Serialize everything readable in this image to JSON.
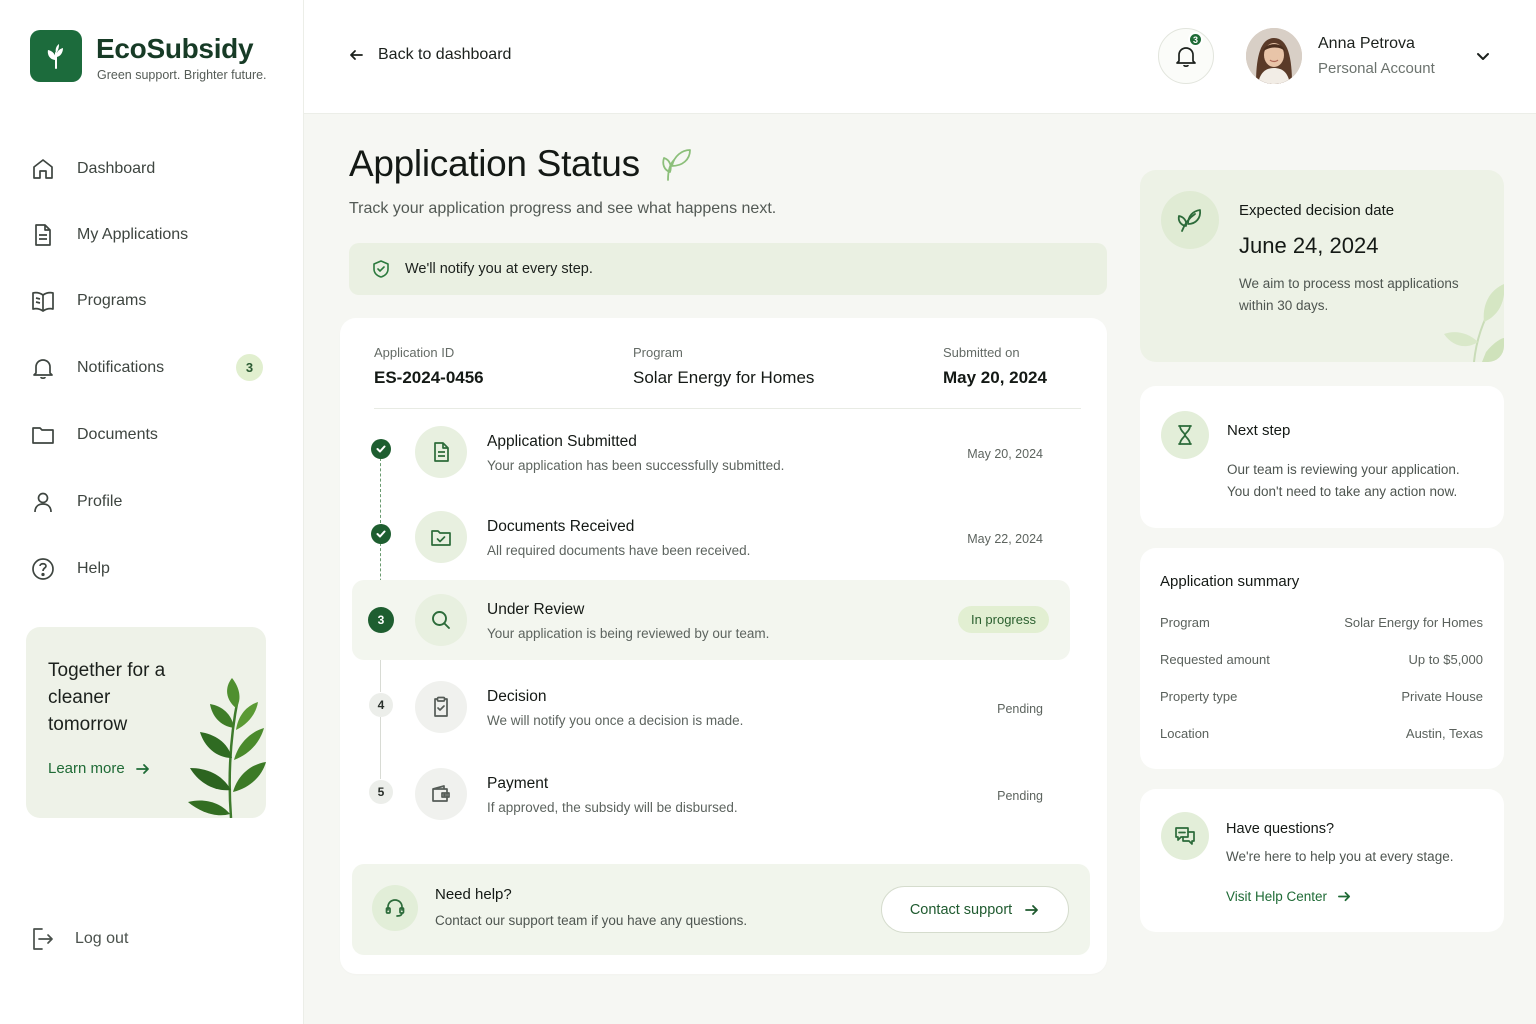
{
  "brand": {
    "name": "EcoSubsidy",
    "tagline": "Green support. Brighter future."
  },
  "nav": [
    {
      "label": "Dashboard",
      "icon": "home-icon"
    },
    {
      "label": "My Applications",
      "icon": "document-icon"
    },
    {
      "label": "Programs",
      "icon": "book-icon"
    },
    {
      "label": "Notifications",
      "icon": "bell-icon",
      "badge": "3"
    },
    {
      "label": "Documents",
      "icon": "folder-icon"
    },
    {
      "label": "Profile",
      "icon": "user-icon"
    },
    {
      "label": "Help",
      "icon": "help-circle-icon"
    }
  ],
  "promo": {
    "title": "Together for a cleaner tomorrow",
    "link": "Learn more"
  },
  "logout": "Log out",
  "header": {
    "back": "Back to dashboard",
    "notifications_count": "3",
    "user_name": "Anna Petrova",
    "user_account": "Personal Account"
  },
  "page": {
    "title": "Application Status",
    "subtitle": "Track your application progress and see what happens next.",
    "notice": "We'll notify you at every step."
  },
  "application": {
    "id_label": "Application ID",
    "id": "ES-2024-0456",
    "program_label": "Program",
    "program": "Solar Energy for Homes",
    "submitted_label": "Submitted on",
    "submitted": "May 20, 2024"
  },
  "steps": [
    {
      "title": "Application Submitted",
      "desc": "Your application has been successfully submitted.",
      "status": "May 20, 2024",
      "state": "done",
      "icon": "file-text-icon"
    },
    {
      "title": "Documents Received",
      "desc": "All required documents have been received.",
      "status": "May 22, 2024",
      "state": "done",
      "icon": "folder-check-icon"
    },
    {
      "num": "3",
      "title": "Under Review",
      "desc": "Your application is being reviewed by our team.",
      "status": "In progress",
      "state": "current",
      "icon": "search-icon"
    },
    {
      "num": "4",
      "title": "Decision",
      "desc": "We will notify you once a decision is made.",
      "status": "Pending",
      "state": "pending",
      "icon": "clipboard-check-icon"
    },
    {
      "num": "5",
      "title": "Payment",
      "desc": "If approved, the subsidy will be disbursed.",
      "status": "Pending",
      "state": "pending",
      "icon": "wallet-icon"
    }
  ],
  "help": {
    "title": "Need help?",
    "desc": "Contact our support team if you have any questions.",
    "button": "Contact support"
  },
  "decision": {
    "label": "Expected decision date",
    "date": "June 24, 2024",
    "note": "We aim to process most applications within 30 days."
  },
  "next_step": {
    "title": "Next step",
    "desc": "Our team is reviewing your application. You don't need to take any action now."
  },
  "summary": {
    "title": "Application summary",
    "rows": [
      {
        "label": "Program",
        "value": "Solar Energy for Homes"
      },
      {
        "label": "Requested amount",
        "value": "Up to $5,000"
      },
      {
        "label": "Property type",
        "value": "Private House"
      },
      {
        "label": "Location",
        "value": "Austin, Texas"
      }
    ]
  },
  "questions": {
    "title": "Have questions?",
    "desc": "We're here to help you at every stage.",
    "link": "Visit Help Center"
  },
  "colors": {
    "primary": "#1e5e30",
    "accent_bg": "#eaf0e2",
    "badge_bg": "#e2efd2"
  }
}
